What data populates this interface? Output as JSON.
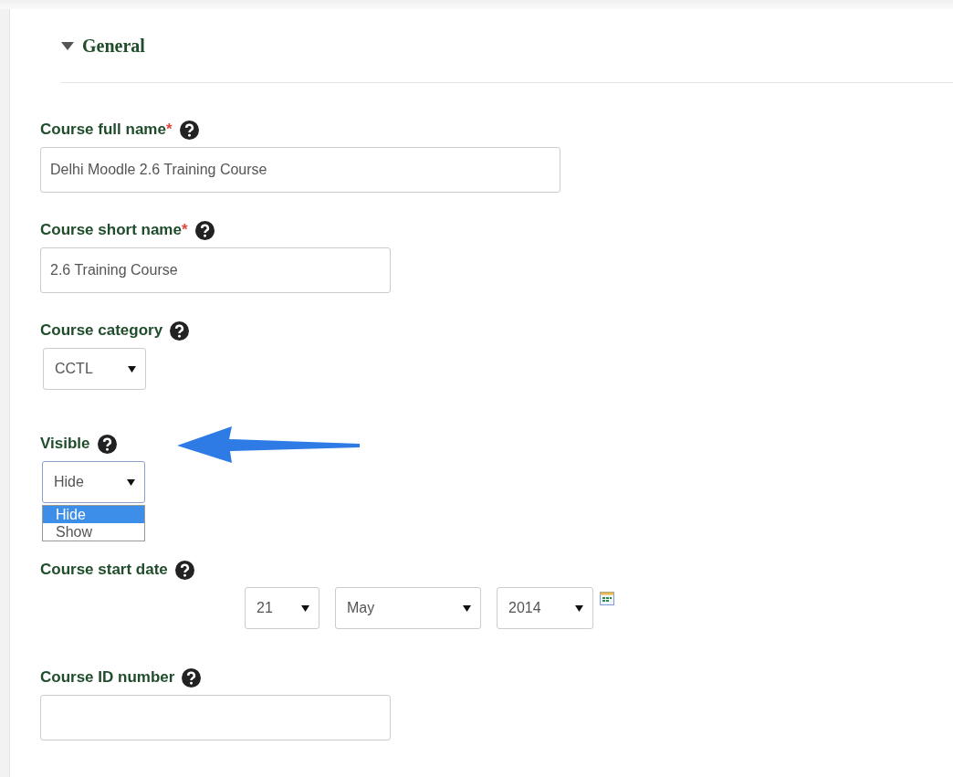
{
  "section": {
    "title": "General",
    "expanded": true
  },
  "fields": [
    {
      "kind": "long_text",
      "label": "Course full name",
      "required_mark": "*",
      "value": "Delhi Moodle 2.6 Training Course"
    },
    {
      "kind": "text",
      "label": "Course short name",
      "required_mark": "*",
      "value": "2.6 Training Course"
    },
    {
      "kind": "select",
      "label": "Course category",
      "value": "CCTL",
      "open": false
    },
    {
      "kind": "select",
      "label": "Visible",
      "value": "Hide",
      "open": true,
      "annotated": true,
      "options": [
        {
          "label": "Hide",
          "selected": true
        },
        {
          "label": "Show",
          "selected": false
        }
      ]
    },
    {
      "kind": "date",
      "label": "Course start date",
      "day": "21",
      "month": "May",
      "year": "2014"
    },
    {
      "kind": "text",
      "label": "Course ID number"
    }
  ]
}
